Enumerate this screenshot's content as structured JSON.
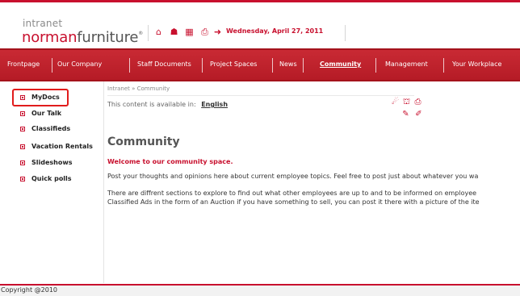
{
  "header": {
    "logo_top": "intranet",
    "logo_norman": "norman",
    "logo_furniture": "furniture",
    "logo_mark": "®",
    "date": "Wednesday, April 27, 2011",
    "icons": [
      "home-icon",
      "sitemap-icon",
      "calendar-icon",
      "print-icon",
      "logout-icon"
    ]
  },
  "nav": {
    "items": [
      {
        "label": "Frontpage"
      },
      {
        "label": "Our Company"
      },
      {
        "label": "Staff Documents"
      },
      {
        "label": "Project Spaces"
      },
      {
        "label": "News"
      },
      {
        "label": "Community"
      },
      {
        "label": "Management"
      },
      {
        "label": "Your Workplace"
      }
    ],
    "active": "Community"
  },
  "sidebar": {
    "items": [
      {
        "label": "MyDocs"
      },
      {
        "label": "Our Talk"
      },
      {
        "label": "Classifieds"
      },
      {
        "label": "Vacation Rentals"
      },
      {
        "label": "Slideshows"
      },
      {
        "label": "Quick polls"
      }
    ]
  },
  "content": {
    "breadcrumb": "Intranet » Community",
    "available_text": "This content is available in:",
    "language": "English",
    "title": "Community",
    "welcome": "Welcome to our community space.",
    "para1": "Post your thoughts and opinions here about current employee topics. Feel free to post just about whatever you wa",
    "para2_line1": "There are diffrent sections to explore to find out what other employees are up to and to be informed on employee",
    "para2_line2": "Classified Ads in the form of an Auction if you have something to sell, you can post it there with a picture of the ite"
  },
  "footer": {
    "copyright": "Copyright @2010"
  },
  "colors": {
    "brand_red": "#c8102e",
    "nav_bg": "#c0222d",
    "highlight_border": "#e11c1c"
  }
}
